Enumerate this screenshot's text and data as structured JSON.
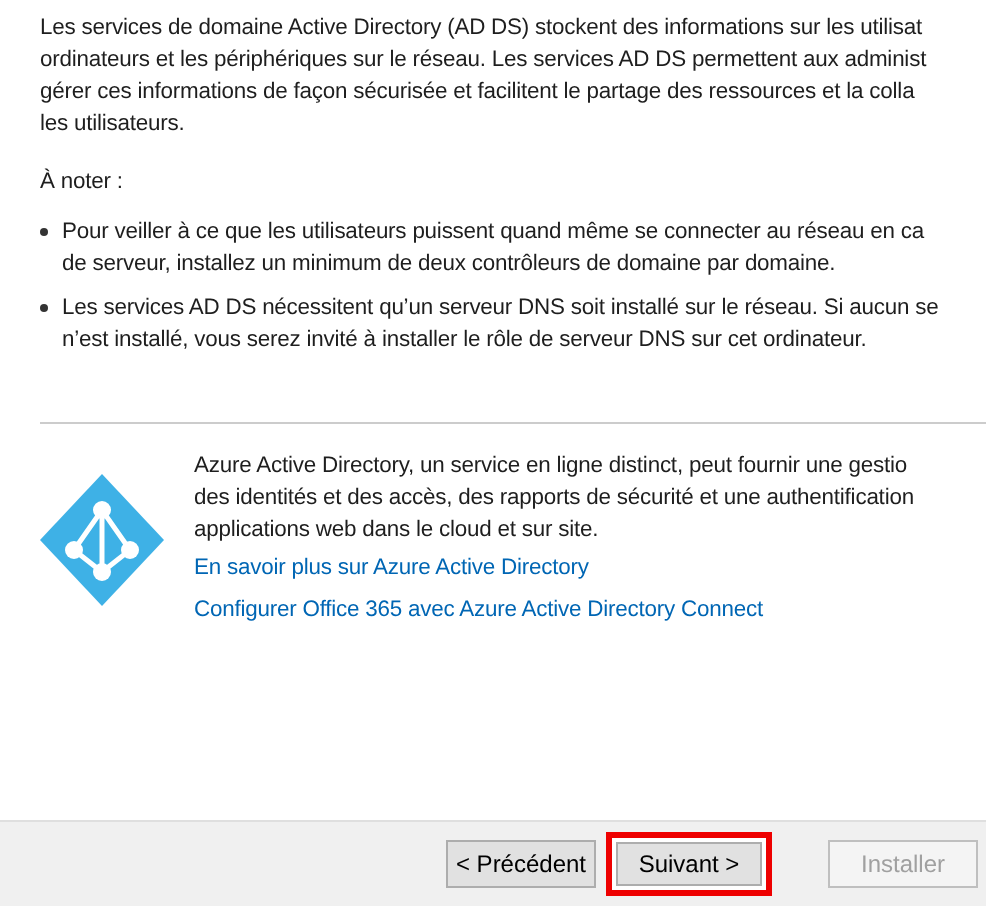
{
  "intro": "Les services de domaine Active Directory (AD DS) stockent des informations sur les utilisat\nordinateurs et les périphériques sur le réseau. Les services AD DS permettent aux administ\ngérer ces informations de façon sécurisée et facilitent le partage des ressources et la colla\nles utilisateurs.",
  "note_heading": "À noter :",
  "notes": [
    "Pour veiller à ce que les utilisateurs puissent quand même se connecter au réseau en ca\nde serveur, installez un minimum de deux contrôleurs de domaine par domaine.",
    "Les services AD DS nécessitent qu’un serveur DNS soit installé sur le réseau. Si aucun se\nn’est installé, vous serez invité à installer le rôle de serveur DNS sur cet ordinateur."
  ],
  "azure": {
    "text": "Azure Active Directory, un service en ligne distinct, peut fournir une gestio\ndes identités et des accès, des rapports de sécurité et une authentification\napplications web dans le cloud et sur site.",
    "links": [
      "En savoir plus sur Azure Active Directory",
      "Configurer Office 365 avec Azure Active Directory Connect"
    ]
  },
  "buttons": [
    {
      "label": "< Précédent",
      "disabled": false,
      "highlighted": false
    },
    {
      "label": "Suivant >",
      "disabled": false,
      "highlighted": true
    },
    {
      "label": "Installer",
      "disabled": true,
      "highlighted": false
    }
  ]
}
